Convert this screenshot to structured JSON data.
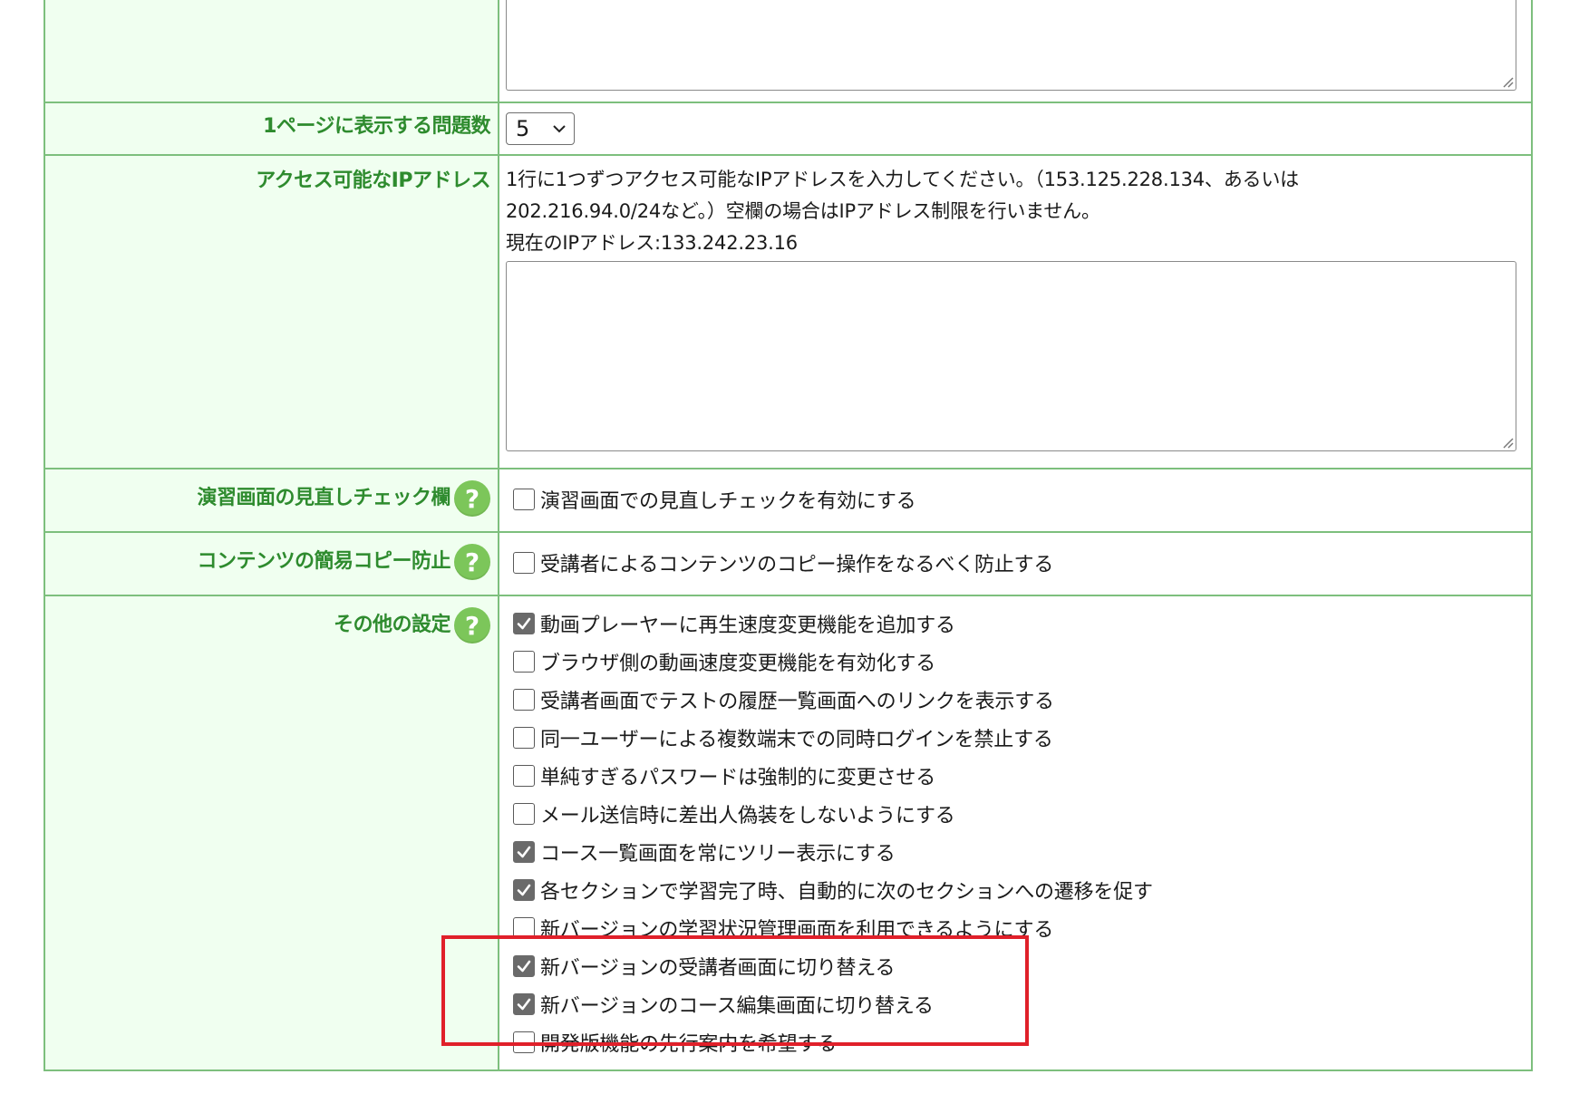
{
  "rows": {
    "per_page": {
      "label": "1ページに表示する問題数",
      "selected": "5"
    },
    "ip": {
      "label": "アクセス可能なIPアドレス",
      "desc_line1": "1行に1つずつアクセス可能なIPアドレスを入力してください。（153.125.228.134、あるいは",
      "desc_line2": "202.216.94.0/24など。）空欄の場合はIPアドレス制限を行いません。",
      "current": "現在のIPアドレス:133.242.23.16"
    },
    "review": {
      "label": "演習画面の見直しチェック欄",
      "option": "演習画面での見直しチェックを有効にする",
      "checked": false
    },
    "copy": {
      "label": "コンテンツの簡易コピー防止",
      "option": "受講者によるコンテンツのコピー操作をなるべく防止する",
      "checked": false
    },
    "other": {
      "label": "その他の設定",
      "options": [
        {
          "label": "動画プレーヤーに再生速度変更機能を追加する",
          "checked": true
        },
        {
          "label": "ブラウザ側の動画速度変更機能を有効化する",
          "checked": false
        },
        {
          "label": "受講者画面でテストの履歴一覧画面へのリンクを表示する",
          "checked": false
        },
        {
          "label": "同一ユーザーによる複数端末での同時ログインを禁止する",
          "checked": false
        },
        {
          "label": "単純すぎるパスワードは強制的に変更させる",
          "checked": false
        },
        {
          "label": "メール送信時に差出人偽装をしないようにする",
          "checked": false
        },
        {
          "label": "コース一覧画面を常にツリー表示にする",
          "checked": true
        },
        {
          "label": "各セクションで学習完了時、自動的に次のセクションへの遷移を促す",
          "checked": true
        },
        {
          "label": "新バージョンの学習状況管理画面を利用できるようにする",
          "checked": false
        },
        {
          "label": "新バージョンの受講者画面に切り替える",
          "checked": true
        },
        {
          "label": "新バージョンのコース編集画面に切り替える",
          "checked": true
        },
        {
          "label": "開発版機能の先行案内を希望する",
          "checked": false
        }
      ]
    }
  },
  "help_icon_glyph": "?",
  "colors": {
    "label_green": "#2e8b2e",
    "label_bg": "#f0fff0",
    "border_green": "#7dbf7d",
    "help_green": "#7cc65a",
    "highlight_red": "#e0202a"
  }
}
